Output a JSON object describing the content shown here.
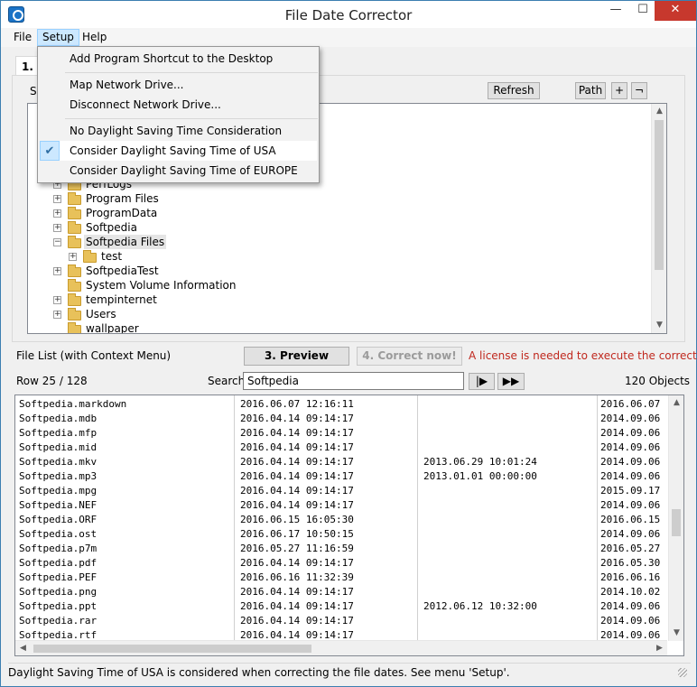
{
  "window": {
    "title": "File Date Corrector",
    "minimize_glyph": "—",
    "maximize_glyph": "☐",
    "close_glyph": "✕"
  },
  "menubar": {
    "items": [
      "File",
      "Setup",
      "Help"
    ],
    "open_item": "Setup"
  },
  "setup_menu": {
    "items": [
      {
        "label": "Add Program Shortcut to the Desktop",
        "checked": false
      },
      {
        "label": "Map Network Drive...",
        "checked": false
      },
      {
        "label": "Disconnect Network Drive...",
        "checked": false
      },
      {
        "label": "No Daylight Saving Time Consideration",
        "checked": false
      },
      {
        "label": "Consider Daylight Saving Time of USA",
        "checked": true
      },
      {
        "label": "Consider Daylight Saving Time of EUROPE",
        "checked": false
      }
    ],
    "check_glyph": "✔"
  },
  "tab": {
    "label": "1. S",
    "partial_label": "S"
  },
  "folder_toolbar": {
    "refresh": "Refresh",
    "path": "Path",
    "plus": "+",
    "minus": "¬"
  },
  "folder_tree": {
    "items": [
      {
        "label": "PerfLogs",
        "depth": 1,
        "expander": "+",
        "selected": false
      },
      {
        "label": "Program Files",
        "depth": 1,
        "expander": "+",
        "selected": false
      },
      {
        "label": "ProgramData",
        "depth": 1,
        "expander": "+",
        "selected": false
      },
      {
        "label": "Softpedia",
        "depth": 1,
        "expander": "+",
        "selected": false
      },
      {
        "label": "Softpedia Files",
        "depth": 1,
        "expander": "−",
        "selected": true
      },
      {
        "label": "test",
        "depth": 2,
        "expander": "+",
        "selected": false
      },
      {
        "label": "SoftpediaTest",
        "depth": 1,
        "expander": "+",
        "selected": false
      },
      {
        "label": "System Volume Information",
        "depth": 1,
        "expander": "",
        "selected": false
      },
      {
        "label": "tempinternet",
        "depth": 1,
        "expander": "+",
        "selected": false
      },
      {
        "label": "Users",
        "depth": 1,
        "expander": "+",
        "selected": false
      },
      {
        "label": "wallpaper",
        "depth": 1,
        "expander": "",
        "selected": false
      }
    ]
  },
  "actions": {
    "file_list_label": "File List (with Context Menu)",
    "preview": "3. Preview",
    "correct": "4. Correct now!",
    "license_msg": "A license is needed to execute the correction."
  },
  "search_bar": {
    "row_counter": "Row 25 / 128",
    "search_label": "Search",
    "search_value": "Softpedia",
    "step_glyph": "|▶",
    "fast_glyph": "▶▶",
    "objects_count": "120 Objects"
  },
  "file_list": {
    "rows": [
      {
        "name": "Softpedia.markdown",
        "d1": "2016.06.07 12:16:11",
        "d2": "",
        "d3": "2016.06.07"
      },
      {
        "name": "Softpedia.mdb",
        "d1": "2016.04.14 09:14:17",
        "d2": "",
        "d3": "2014.09.06"
      },
      {
        "name": "Softpedia.mfp",
        "d1": "2016.04.14 09:14:17",
        "d2": "",
        "d3": "2014.09.06"
      },
      {
        "name": "Softpedia.mid",
        "d1": "2016.04.14 09:14:17",
        "d2": "",
        "d3": "2014.09.06"
      },
      {
        "name": "Softpedia.mkv",
        "d1": "2016.04.14 09:14:17",
        "d2": "2013.06.29 10:01:24",
        "d3": "2014.09.06"
      },
      {
        "name": "Softpedia.mp3",
        "d1": "2016.04.14 09:14:17",
        "d2": "2013.01.01 00:00:00",
        "d3": "2014.09.06"
      },
      {
        "name": "Softpedia.mpg",
        "d1": "2016.04.14 09:14:17",
        "d2": "",
        "d3": "2015.09.17"
      },
      {
        "name": "Softpedia.NEF",
        "d1": "2016.04.14 09:14:17",
        "d2": "",
        "d3": "2014.09.06"
      },
      {
        "name": "Softpedia.ORF",
        "d1": "2016.06.15 16:05:30",
        "d2": "",
        "d3": "2016.06.15"
      },
      {
        "name": "Softpedia.ost",
        "d1": "2016.06.17 10:50:15",
        "d2": "",
        "d3": "2014.09.06"
      },
      {
        "name": "Softpedia.p7m",
        "d1": "2016.05.27 11:16:59",
        "d2": "",
        "d3": "2016.05.27"
      },
      {
        "name": "Softpedia.pdf",
        "d1": "2016.04.14 09:14:17",
        "d2": "",
        "d3": "2016.05.30"
      },
      {
        "name": "Softpedia.PEF",
        "d1": "2016.06.16 11:32:39",
        "d2": "",
        "d3": "2016.06.16"
      },
      {
        "name": "Softpedia.png",
        "d1": "2016.04.14 09:14:17",
        "d2": "",
        "d3": "2014.10.02"
      },
      {
        "name": "Softpedia.ppt",
        "d1": "2016.04.14 09:14:17",
        "d2": "2012.06.12 10:32:00",
        "d3": "2014.09.06"
      },
      {
        "name": "Softpedia.rar",
        "d1": "2016.04.14 09:14:17",
        "d2": "",
        "d3": "2014.09.06"
      },
      {
        "name": "Softpedia.rtf",
        "d1": "2016.04.14 09:14:17",
        "d2": "",
        "d3": "2014.09.06"
      }
    ]
  },
  "status": "Daylight Saving Time of USA is considered when correcting the file dates. See menu 'Setup'."
}
